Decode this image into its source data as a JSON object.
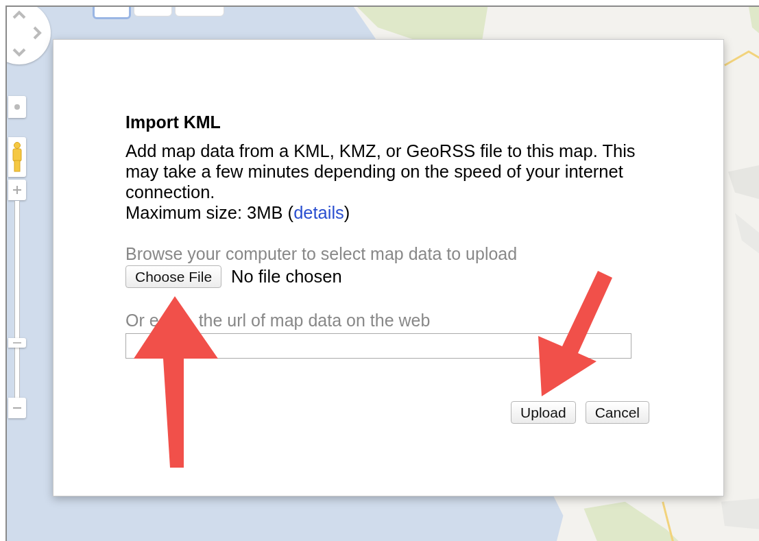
{
  "map_controls": {
    "map_type_buttons": [
      {
        "selected": true
      },
      {
        "selected": false
      },
      {
        "selected": false
      }
    ],
    "zoom": {
      "level": 0.27
    }
  },
  "dialog": {
    "title": "Import KML",
    "description": "Add map data from a KML, KMZ, or GeoRSS file to this map. This may take a few minutes depending on the speed of your internet connection.",
    "size_note": {
      "before": "Maximum size: 3MB (",
      "link": "details",
      "after": ")"
    },
    "file_picker": {
      "label": "Browse your computer to select map data to upload",
      "button": "Choose File",
      "status": "No file chosen"
    },
    "url_field": {
      "label_parts": [
        "Or e",
        "the url of map data on the web"
      ]
    },
    "buttons": [
      "Upload",
      "Cancel"
    ]
  }
}
